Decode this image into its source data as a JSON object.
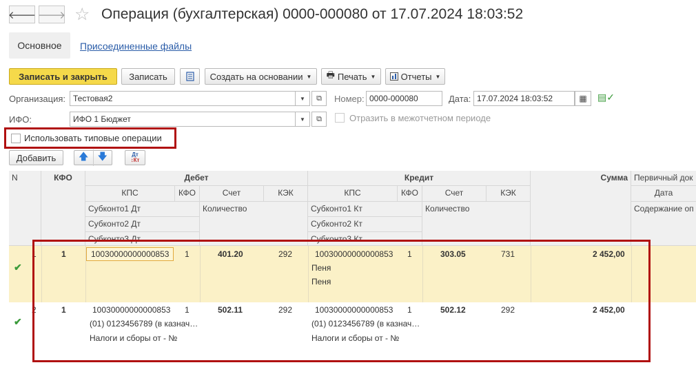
{
  "nav": {
    "back_icon": "arrow-left-icon",
    "forward_icon": "arrow-right-icon",
    "star_icon": "star-icon"
  },
  "window": {
    "title": "Операция (бухгалтерская) 0000-000080 от 17.07.2024 18:03:52"
  },
  "tabs": [
    {
      "label": "Основное",
      "active": true
    },
    {
      "label": "Присоединенные файлы",
      "active": false
    }
  ],
  "toolbar": {
    "save_close": "Записать и закрыть",
    "save": "Записать",
    "create_based": "Создать на основании",
    "print": "Печать",
    "reports": "Отчеты"
  },
  "form": {
    "org_label": "Организация:",
    "org_value": "Тестовая2",
    "number_label": "Номер:",
    "number_value": "0000-000080",
    "date_label": "Дата:",
    "date_value": "17.07.2024 18:03:52",
    "ifo_label": "ИФО:",
    "ifo_value": "ИФО 1 Бюджет",
    "interperiod_label": "Отразить в межотчетном периоде",
    "typical_label": "Использовать типовые операции"
  },
  "table_toolbar": {
    "add": "Добавить"
  },
  "grid": {
    "headers": {
      "n": "N",
      "kfo": "КФО",
      "debit": "Дебет",
      "credit": "Кредит",
      "sum": "Сумма",
      "primary_doc": "Первичный док",
      "kps": "КПС",
      "kfo_sub": "КФО",
      "account": "Счет",
      "kek": "КЭК",
      "quantity": "Количество",
      "date": "Дата",
      "content": "Содержание оп",
      "sub1_dt": "Субконто1 Дт",
      "sub2_dt": "Субконто2 Дт",
      "sub3_dt": "Субконто3 Дт",
      "sub1_kt": "Субконто1 Кт",
      "sub2_kt": "Субконто2 Кт",
      "sub3_kt": "Субконто3 Кт"
    },
    "rows": [
      {
        "n": "1",
        "kfo": "1",
        "d_kps": "10030000000000853",
        "d_kfo": "1",
        "d_account": "401.20",
        "d_kek": "292",
        "d_sub1": "",
        "d_sub2": "",
        "d_sub3": "",
        "c_kps": "10030000000000853",
        "c_kfo": "1",
        "c_account": "303.05",
        "c_kek": "731",
        "c_sub1": "Пеня",
        "c_sub2": "Пеня",
        "sum": "2 452,00"
      },
      {
        "n": "2",
        "kfo": "1",
        "d_kps": "10030000000000853",
        "d_kfo": "1",
        "d_account": "502.11",
        "d_kek": "292",
        "d_sub1": "(01) 0123456789 (в казнач…",
        "d_sub2": "Налоги и сборы от - №",
        "c_kps": "10030000000000853",
        "c_kfo": "1",
        "c_account": "502.12",
        "c_kek": "292",
        "c_sub1": "(01) 0123456789 (в казнач…",
        "c_sub2": "Налоги и сборы от - №",
        "sum": "2 452,00"
      }
    ]
  },
  "colors": {
    "accent": "#f5d94a",
    "selected_row": "#fbf1c7",
    "highlight": "#b01010",
    "link": "#2a5ca8"
  }
}
